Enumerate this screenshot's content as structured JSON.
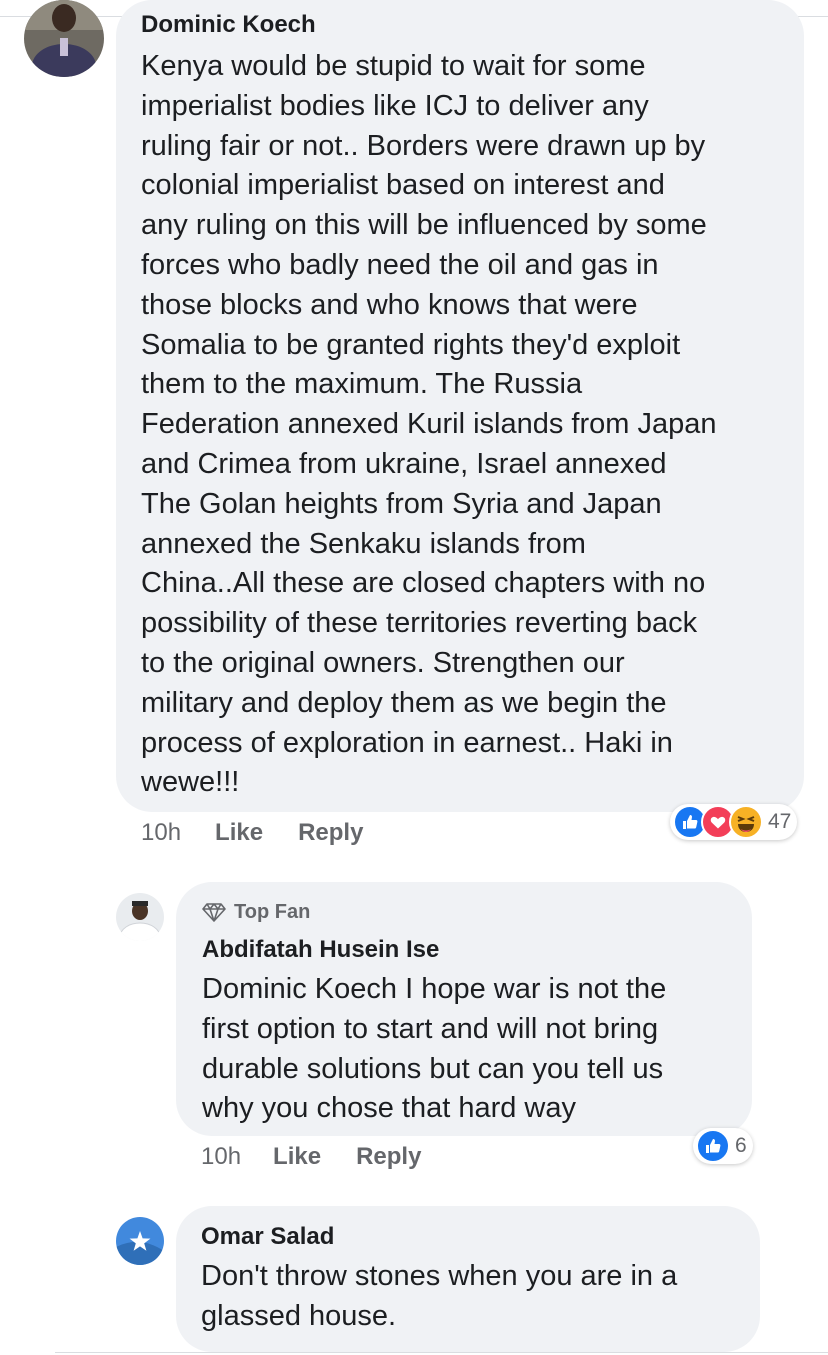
{
  "comments": [
    {
      "author": "Dominic Koech",
      "text": "Kenya would be stupid to wait for some\nimperialist bodies like ICJ to deliver any\nruling fair or not.. Borders were drawn up by\ncolonial imperialist based on interest and\nany ruling on this will be influenced by some\nforces who badly need the oil and gas in\nthose blocks and who knows that were\nSomalia to be granted rights they'd exploit\nthem to the maximum. The Russia\nFederation annexed Kuril islands from Japan\nand Crimea from ukraine, Israel annexed\nThe Golan heights from Syria and Japan\nannexed the Senkaku islands from\nChina..All these are closed chapters with no\npossibility of these territories reverting back\nto the original owners. Strengthen our\nmilitary and deploy them as we begin the\nprocess of exploration in earnest.. Haki in\nwewe!!!",
      "time": "10h",
      "like_label": "Like",
      "reply_label": "Reply",
      "reaction_icons": [
        "like-icon",
        "love-icon",
        "haha-icon"
      ],
      "reaction_count": "47"
    },
    {
      "badge": "Top Fan",
      "badge_icon": "diamond-icon",
      "author": "Abdifatah Husein Ise",
      "text": "Dominic Koech I hope war is not the\nfirst option to start and will not bring\ndurable solutions but can you tell us\nwhy you chose that hard way",
      "time": "10h",
      "like_label": "Like",
      "reply_label": "Reply",
      "reaction_icons": [
        "like-icon"
      ],
      "reaction_count": "6"
    },
    {
      "author": "Omar Salad",
      "text": "Don't throw stones when you are in a\nglassed house."
    }
  ],
  "colors": {
    "bubble": "#f0f2f5",
    "meta_text": "#65676b",
    "like_blue": "#1877f2",
    "love_red": "#f33e58",
    "haha_yellow": "#f7b125",
    "somalia_flag": "#4189dd"
  }
}
